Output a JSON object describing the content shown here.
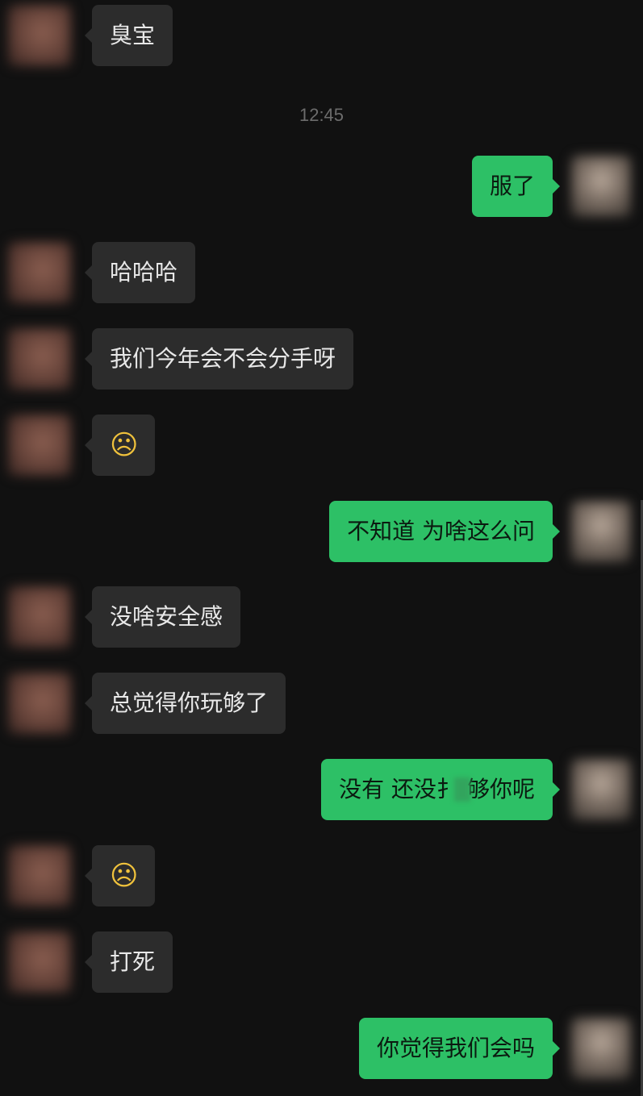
{
  "timestamp": "12:45",
  "messages": [
    {
      "side": "in",
      "text": "臭宝"
    },
    {
      "side": "out",
      "text": "服了"
    },
    {
      "side": "in",
      "text": "哈哈哈"
    },
    {
      "side": "in",
      "text": "我们今年会不会分手呀"
    },
    {
      "side": "in",
      "emoji": "sad-face"
    },
    {
      "side": "out",
      "text": "不知道 为啥这么问"
    },
    {
      "side": "in",
      "text": "没啥安全感"
    },
    {
      "side": "in",
      "text": "总觉得你玩够了"
    },
    {
      "side": "out",
      "text_before": "没有 还没扌",
      "text_after": "够你呢"
    },
    {
      "side": "in",
      "emoji": "sad-face"
    },
    {
      "side": "in",
      "text": "打死"
    },
    {
      "side": "out",
      "text": "你觉得我们会吗"
    }
  ],
  "colors": {
    "background": "#111111",
    "incoming_bubble": "#2c2c2c",
    "outgoing_bubble": "#2dc066",
    "timestamp": "#6c6c6c"
  }
}
